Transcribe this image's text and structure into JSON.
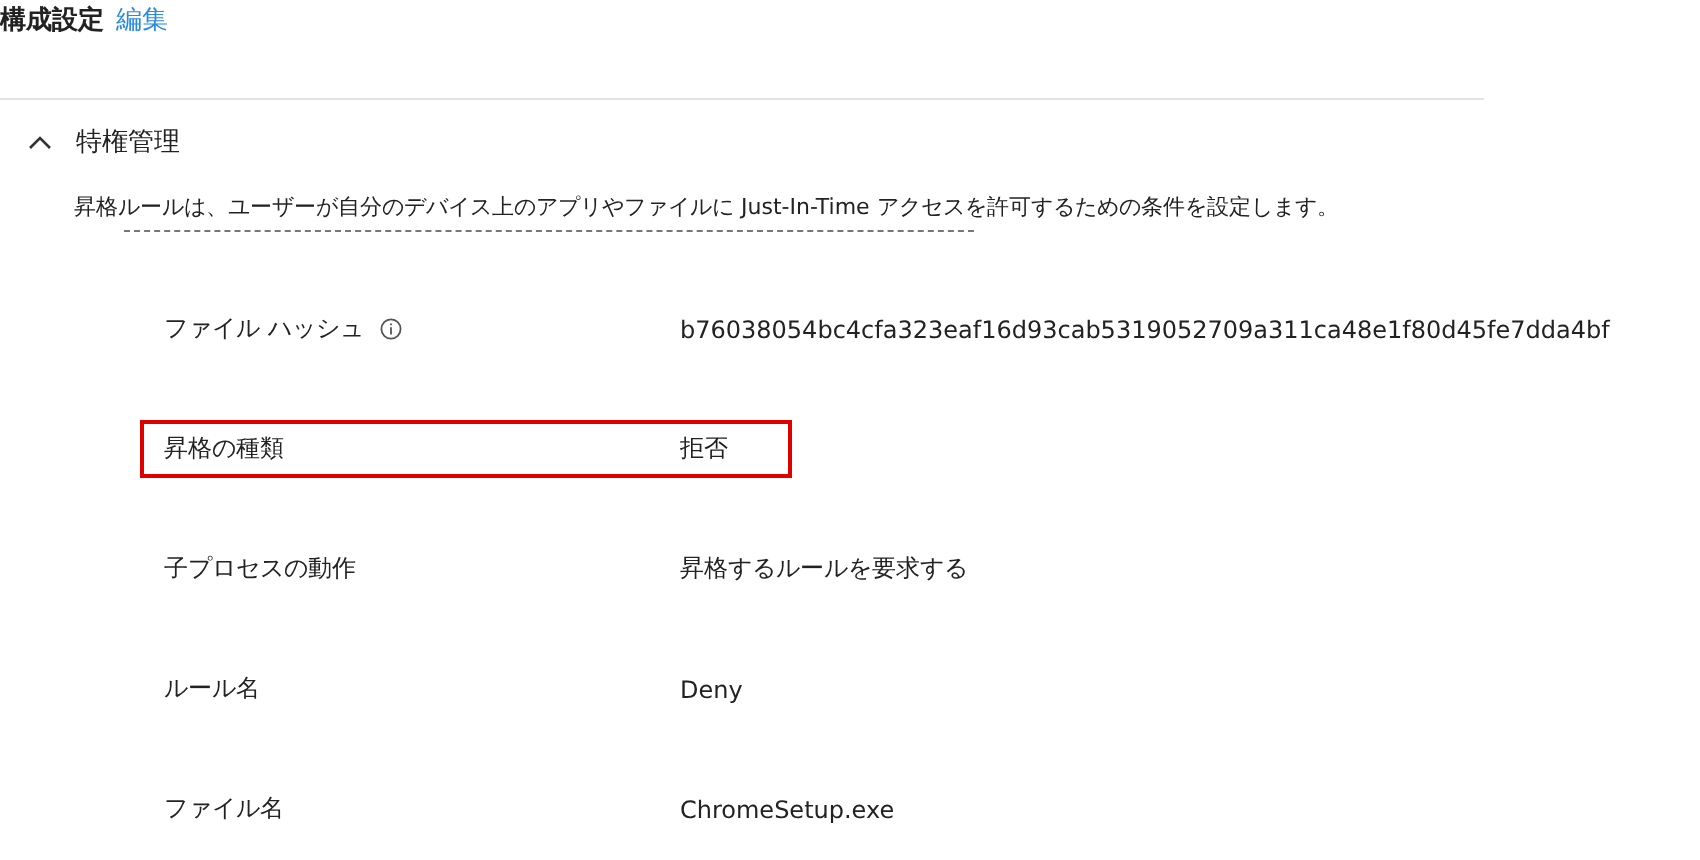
{
  "header": {
    "title": "構成設定",
    "edit_link": "編集"
  },
  "section": {
    "title": "特権管理",
    "expanded": true,
    "description": "昇格ルールは、ユーザーが自分のデバイス上のアプリやファイルに Just-In-Time アクセスを許可するための条件を設定します。"
  },
  "rows": [
    {
      "label": "ファイル ハッシュ",
      "info": true,
      "value": "b76038054bc4cfa323eaf16d93cab5319052709a311ca48e1f80d45fe7dda4bf",
      "highlighted": false
    },
    {
      "label": "昇格の種類",
      "info": false,
      "value": "拒否",
      "highlighted": true
    },
    {
      "label": "子プロセスの動作",
      "info": false,
      "value": "昇格するルールを要求する",
      "highlighted": false
    },
    {
      "label": "ルール名",
      "info": false,
      "value": "Deny",
      "highlighted": false
    },
    {
      "label": "ファイル名",
      "info": false,
      "value": "ChromeSetup.exe",
      "highlighted": false
    }
  ]
}
